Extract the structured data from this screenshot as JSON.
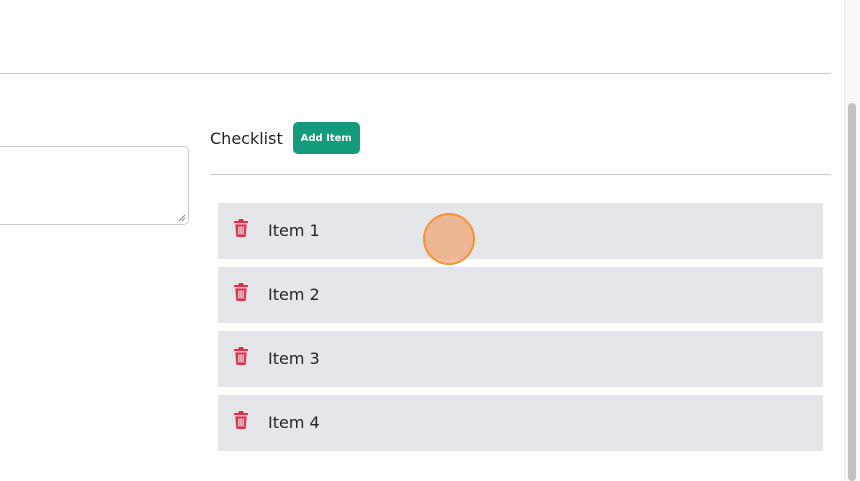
{
  "description_field": {
    "value": ""
  },
  "checklist": {
    "title": "Checklist",
    "add_button_label": "Add Item",
    "items": [
      {
        "label": "Item 1",
        "icon": "trash-icon"
      },
      {
        "label": "Item 2",
        "icon": "trash-icon"
      },
      {
        "label": "Item 3",
        "icon": "trash-icon"
      },
      {
        "label": "Item 4",
        "icon": "trash-icon"
      }
    ]
  },
  "colors": {
    "accent": "#149b7e",
    "delete_icon": "#dc3545",
    "item_background": "#e5e6e9",
    "cursor_fill": "#f0a06e",
    "cursor_stroke": "#f59331"
  }
}
